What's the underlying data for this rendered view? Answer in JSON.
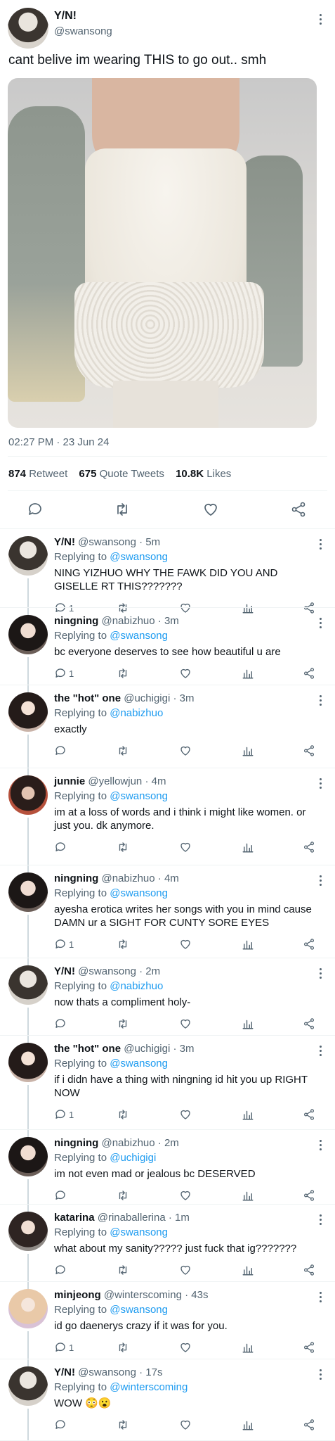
{
  "main_tweet": {
    "name": "Y/N!",
    "handle": "@swansong",
    "text": "cant belive im wearing THIS to go out.. smh",
    "timestamp": "02:27 PM · 23 Jun 24",
    "retweets": "874",
    "retweets_label": "Retweet",
    "quotes": "675",
    "quotes_label": "Quote Tweets",
    "likes": "10.8K",
    "likes_label": "Likes"
  },
  "replying_to_label": "Replying to",
  "replies": [
    {
      "name": "Y/N!",
      "handle": "@swansong",
      "time": "5m",
      "replying_to": "@swansong",
      "text": "NING YIZHUO WHY THE FAWK DID YOU AND GISELLE RT THIS???????",
      "reply_count": "1"
    },
    {
      "name": "ningning",
      "handle": "@nabizhuo",
      "time": "3m",
      "replying_to": "@swansong",
      "text": "bc everyone deserves to see how beautiful u are",
      "reply_count": "1"
    },
    {
      "name": "the \"hot\" one",
      "handle": "@uchigigi",
      "time": "3m",
      "replying_to": "@nabizhuo",
      "text": "exactly",
      "reply_count": ""
    },
    {
      "name": "junnie",
      "handle": "@yellowjun",
      "time": "4m",
      "replying_to": "@swansong",
      "text": "im at a loss of words and i think i might like women. or just you. dk anymore.",
      "reply_count": ""
    },
    {
      "name": "ningning",
      "handle": "@nabizhuo",
      "time": "4m",
      "replying_to": "@swansong",
      "text": "ayesha erotica writes her songs with you in mind cause DAMN ur a SIGHT FOR CUNTY SORE EYES",
      "reply_count": "1"
    },
    {
      "name": "Y/N!",
      "handle": "@swansong",
      "time": "2m",
      "replying_to": "@nabizhuo",
      "text": "now thats a compliment holy-",
      "reply_count": ""
    },
    {
      "name": "the \"hot\" one",
      "handle": "@uchigigi",
      "time": "3m",
      "replying_to": "@swansong",
      "text": "if i didn have a thing with ningning id hit you up RIGHT NOW",
      "reply_count": "1"
    },
    {
      "name": "ningning",
      "handle": "@nabizhuo",
      "time": "2m",
      "replying_to": "@uchigigi",
      "text": "im not even mad or jealous bc DESERVED",
      "reply_count": ""
    },
    {
      "name": "katarina",
      "handle": "@rinaballerina",
      "time": "1m",
      "replying_to": "@swansong",
      "text": "what about my sanity????? just fuck that ig???????",
      "reply_count": ""
    },
    {
      "name": "minjeong",
      "handle": "@winterscoming",
      "time": "43s",
      "replying_to": "@swansong",
      "text": "id go daenerys crazy if it was for you.",
      "reply_count": "1"
    },
    {
      "name": "Y/N!",
      "handle": "@swansong",
      "time": "17s",
      "replying_to": "@winterscoming",
      "text": "WOW 😳😮",
      "reply_count": ""
    }
  ],
  "colors": {
    "link": "#1d9bf0",
    "muted": "#536471",
    "text": "#0f1419",
    "divider": "#eff3f4"
  },
  "icons": [
    "reply-icon",
    "retweet-icon",
    "like-icon",
    "share-icon",
    "analytics-icon",
    "more-icon"
  ]
}
